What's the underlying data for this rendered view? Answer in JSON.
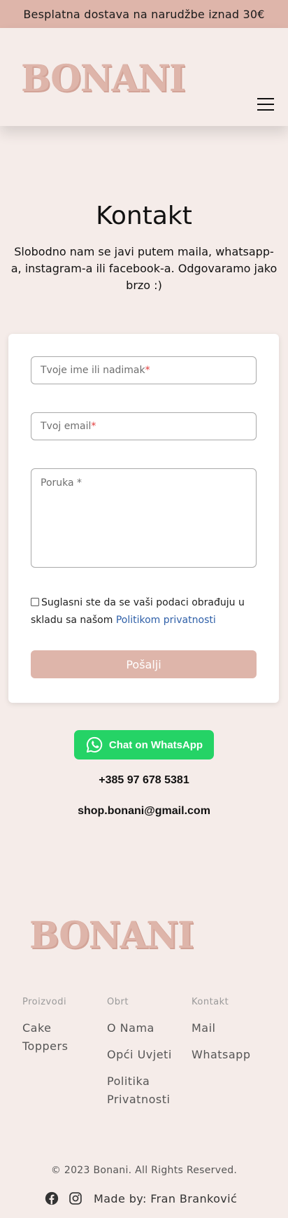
{
  "announcement": "Besplatna dostava na narudžbe iznad 30€",
  "brand": {
    "logo_text": "BONANI"
  },
  "colors": {
    "accent": "#deb5aa",
    "background": "#f5ece9",
    "whatsapp": "#25d366",
    "link": "#2e5fa8",
    "required": "#e23c3c"
  },
  "icons": {
    "menu": "hamburger-icon",
    "whatsapp": "whatsapp-icon",
    "facebook": "facebook-icon",
    "instagram": "instagram-icon"
  },
  "page": {
    "title": "Kontakt",
    "subtitle": "Slobodno nam se javi putem maila, whatsapp-a, instagram-a ili facebook-a. Odgovaramo jako brzo :)"
  },
  "form": {
    "name_placeholder": "Tvoje ime ili nadimak",
    "email_placeholder": "Tvoj email",
    "message_placeholder": "Poruka *",
    "required_mark": "*",
    "consent_text": "Suglasni ste da se vaši podaci obrađuju u skladu sa našom",
    "consent_link": "Politikom privatnosti",
    "consent_checked": false,
    "submit_label": "Pošalji"
  },
  "contact": {
    "whatsapp_label": "Chat on WhatsApp",
    "phone": "+385 97 678 5381",
    "email": "shop.bonani@gmail.com"
  },
  "footer": {
    "logo_text": "BONANI",
    "columns": [
      {
        "heading": "Proizvodi",
        "links": [
          "Cake Toppers"
        ]
      },
      {
        "heading": "Obrt",
        "links": [
          "O Nama",
          "Opći Uvjeti",
          "Politika Privatnosti"
        ]
      },
      {
        "heading": "Kontakt",
        "links": [
          "Mail",
          "Whatsapp"
        ]
      }
    ],
    "copyright": "© 2023 Bonani. All Rights Reserved.",
    "made_by": "Made by: Fran Branković"
  }
}
